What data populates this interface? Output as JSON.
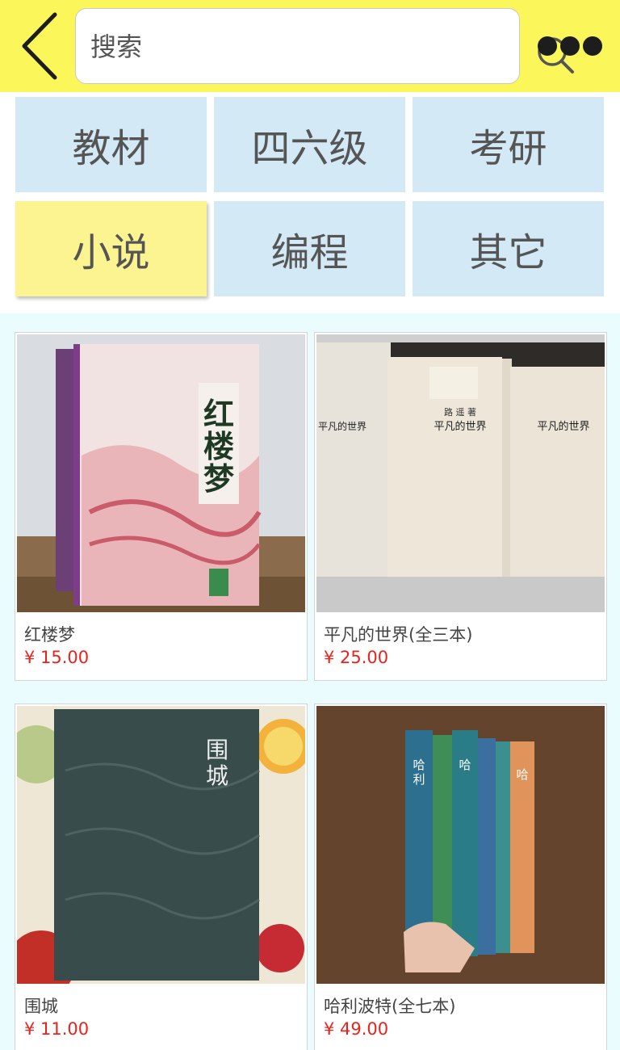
{
  "search": {
    "placeholder": "搜索"
  },
  "categories": [
    {
      "label": "教材"
    },
    {
      "label": "四六级"
    },
    {
      "label": "考研"
    },
    {
      "label": "小说"
    },
    {
      "label": "编程"
    },
    {
      "label": "其它"
    }
  ],
  "active_category": "小说",
  "products": [
    {
      "name": "红楼梦",
      "price": "¥ 15.00",
      "cover_text": "红楼梦",
      "cover_icon": "book-cover-image"
    },
    {
      "name": "平凡的世界(全三本)",
      "price": "¥ 25.00",
      "cover_text": "平凡的世界",
      "cover_icon": "book-cover-image"
    },
    {
      "name": "围城",
      "price": "¥ 11.00",
      "cover_text": "围城",
      "cover_icon": "book-cover-image"
    },
    {
      "name": "哈利波特(全七本)",
      "price": "¥ 49.00",
      "cover_text": "哈利·波特",
      "cover_icon": "book-cover-image"
    }
  ],
  "colors": {
    "header": "#fbf659",
    "category_bg": "#d3e9f6",
    "category_active": "#fbf491",
    "price": "#e8231c",
    "page_bg": "#eafcfd"
  }
}
